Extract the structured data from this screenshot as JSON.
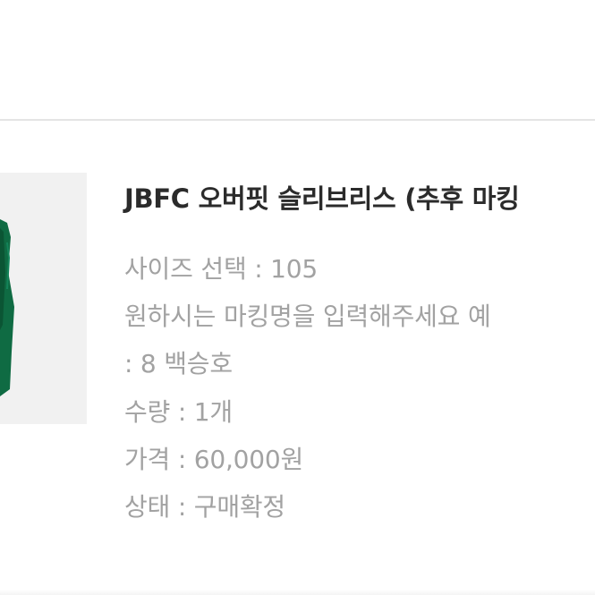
{
  "order": {
    "title": "JBFC 오버핏 슬리브리스 (추후 마킹",
    "size_line": "사이즈 선택 : 105",
    "marking_line_1": "원하시는 마킹명을 입력해주세요 예",
    "marking_line_2": ": 8 백승호",
    "quantity_line": "수량 : 1개",
    "price_line": "가격 : 60,000원",
    "status_line": "상태 : 구매확정"
  },
  "colors": {
    "jersey_green": "#0f6b43",
    "title_text": "#2b2b2b",
    "detail_text": "#a2a2a2",
    "thumb_bg": "#f1f1f1"
  },
  "icons": {
    "thumbnail": "green-jersey-thumbnail"
  }
}
